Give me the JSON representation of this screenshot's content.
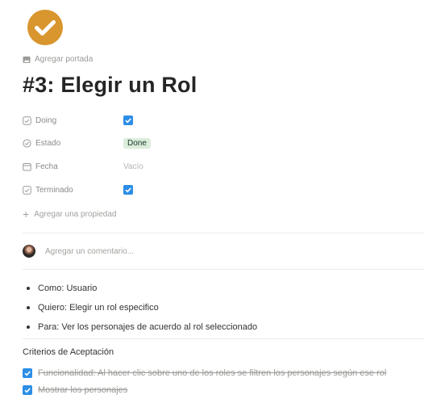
{
  "page": {
    "icon": "checkmark-circle-icon",
    "add_cover_label": "Agregar portada",
    "title": "#3: Elegir un Rol"
  },
  "properties": [
    {
      "name": "Doing",
      "icon": "checkbox-icon",
      "type": "checkbox",
      "checked": true
    },
    {
      "name": "Estado",
      "icon": "status-icon",
      "type": "tag",
      "value": "Done"
    },
    {
      "name": "Fecha",
      "icon": "calendar-icon",
      "type": "text",
      "value": "Vacío"
    },
    {
      "name": "Terminado",
      "icon": "checkbox-icon",
      "type": "checkbox",
      "checked": true
    }
  ],
  "add_property_label": "Agregar una propiedad",
  "comment": {
    "placeholder": "Agregar un comentario..."
  },
  "bullets": [
    "Como: Usuario",
    "Quiero: Elegir un rol especifico",
    "Para: Ver los personajes de acuerdo al rol seleccionado"
  ],
  "criteria": {
    "title": "Criterios de Aceptación",
    "items": [
      {
        "text": "Funcionalidad: Al hacer clic sobre uno de los roles se filtren los personajes según ese rol",
        "checked": true
      },
      {
        "text": "Mostrar los personajes",
        "checked": true
      }
    ]
  },
  "colors": {
    "icon_orange": "#d9962e",
    "checkbox_blue": "#2d8ee6",
    "tag_green_bg": "#dbeddb"
  }
}
